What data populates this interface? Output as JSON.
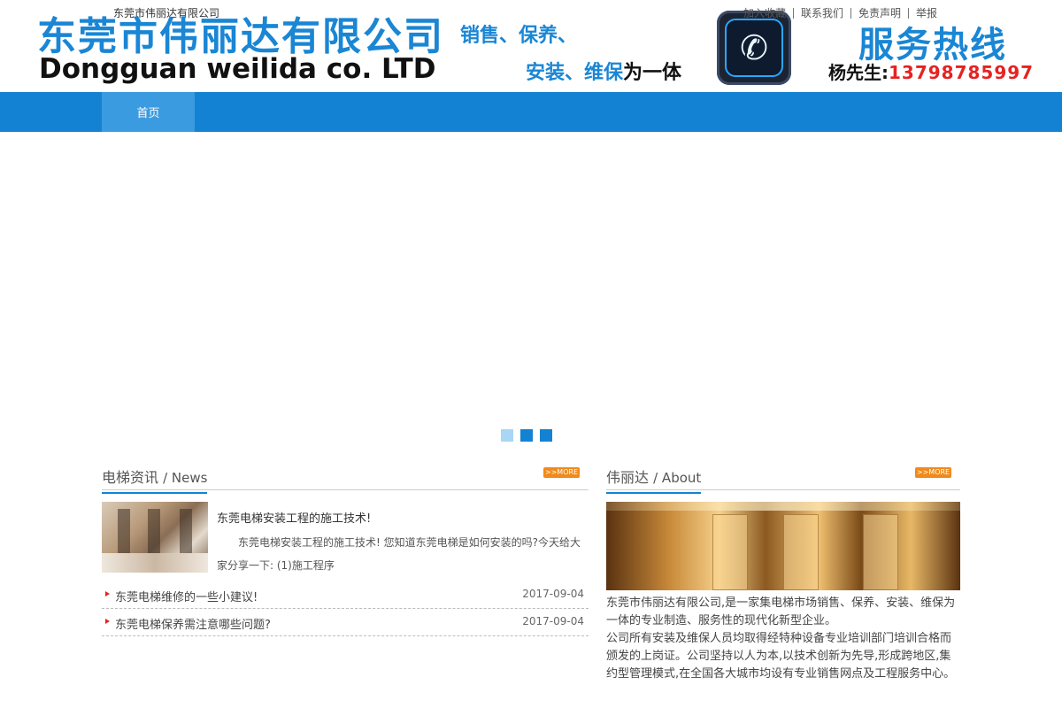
{
  "header": {
    "small_company": "东莞市伟丽达有限公司",
    "logo_cn": "东莞市伟丽达有限公司",
    "logo_en": "Dongguan weilida co. LTD",
    "slogan_line1": "销售、保养、",
    "slogan_line2_blue": "安装、维保",
    "slogan_line2_dark": "为一体",
    "phone_icon": "phone-icon",
    "top_links": [
      "加入收藏",
      "联系我们",
      "免责声明",
      "举报"
    ],
    "hotline_title": "服务热线",
    "hotline_contact": "杨先生:",
    "hotline_number": "13798785997"
  },
  "nav": {
    "items": [
      "首页"
    ]
  },
  "news": {
    "title_cn": "电梯资讯",
    "title_en": "/ News",
    "more_label": ">>MORE",
    "featured_title": "东莞电梯安装工程的施工技术!",
    "featured_desc": "东莞电梯安装工程的施工技术! 您知道东莞电梯是如何安装的吗?今天给大家分享一下: (1)施工程序",
    "items": [
      {
        "title": "东莞电梯维修的一些小建议!",
        "date": "2017-09-04"
      },
      {
        "title": "东莞电梯保养需注意哪些问题?",
        "date": "2017-09-04"
      }
    ]
  },
  "about": {
    "title_cn": "伟丽达",
    "title_en": "/ About",
    "more_label": ">>MORE",
    "para1": "东莞市伟丽达有限公司,是一家集电梯市场销售、保养、安装、维保为一体的专业制造、服务性的现代化新型企业。",
    "para2": "公司所有安装及维保人员均取得经特种设备专业培训部门培训合格而颁发的上岗证。公司坚持以人为本,以技术创新为先导,形成跨地区,集约型管理模式,在全国各大城市均设有专业销售网点及工程服务中心。"
  },
  "colors": {
    "brand_blue": "#1482d2",
    "hotline_red": "#e52222",
    "more_orange": "#f08a1a"
  }
}
